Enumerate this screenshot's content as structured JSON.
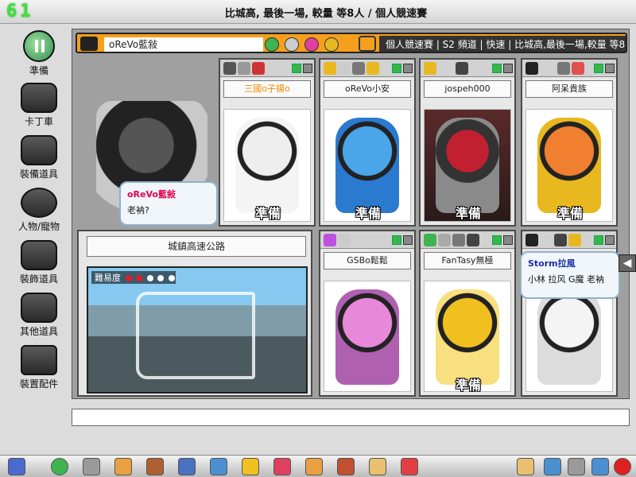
{
  "fps": "61",
  "window_title": "比城高, 最後一場, 較量 等8人 / 個人競速賽",
  "sidebar": {
    "items": [
      {
        "label": "準備",
        "icon": "ready-pause-icon"
      },
      {
        "label": "卡丁車",
        "icon": "kart-icon"
      },
      {
        "label": "裝備道具",
        "icon": "equipment-icon"
      },
      {
        "label": "人物/寵物",
        "icon": "character-icon"
      },
      {
        "label": "裝飾道具",
        "icon": "decoration-icon"
      },
      {
        "label": "其他道具",
        "icon": "items-icon"
      },
      {
        "label": "裝置配件",
        "icon": "parts-icon"
      }
    ]
  },
  "room": {
    "owner_name": "oReVo藍敍",
    "mode": "個人競速賽",
    "channel": "S2 頻道",
    "speed": "快速",
    "room_title": "比城高,最後一場,較量 等8人",
    "info_line": "個人競速賽 | S2 頻道 | 快速 | 比城高,最後一場,較量 等8人"
  },
  "self_player": {
    "bubble_name": "oReVo藍敍",
    "bubble_message": "老衲?"
  },
  "players": [
    {
      "name": "三國o子揚o",
      "ready_label": "準備",
      "name_color": "gold"
    },
    {
      "name": "oReVo小安",
      "ready_label": "準備",
      "name_color": "normal"
    },
    {
      "name": "jospeh000",
      "ready_label": "準備",
      "name_color": "normal"
    },
    {
      "name": "阿呆貴族",
      "ready_label": "準備",
      "name_color": "normal"
    },
    {
      "name": "GSBo鬆鬆",
      "ready_label": "",
      "name_color": "normal"
    },
    {
      "name": "FanTasy無極",
      "ready_label": "準備",
      "name_color": "normal"
    },
    {
      "name": "",
      "ready_label": "",
      "name_color": "normal"
    }
  ],
  "chat_bubble": {
    "name": "Storm拉風",
    "message": "小林 拉风 G魔 老衲"
  },
  "track": {
    "name": "城鎮高速公路",
    "difficulty_label": "難易度",
    "difficulty_level": 2,
    "difficulty_max": 5
  },
  "colors": {
    "room_bar": "#f59f1c",
    "ready_green": "#39b54a"
  },
  "taskbar_icons": [
    "home-icon",
    "back-icon",
    "shop-icon",
    "character-icon",
    "box-icon",
    "bowling-icon",
    "gift-icon",
    "heart-icon",
    "tool-icon",
    "mail-icon",
    "book-icon",
    "kart-icon",
    "note-icon",
    "settings-icon",
    "wrench-icon",
    "search-icon",
    "power-icon"
  ]
}
